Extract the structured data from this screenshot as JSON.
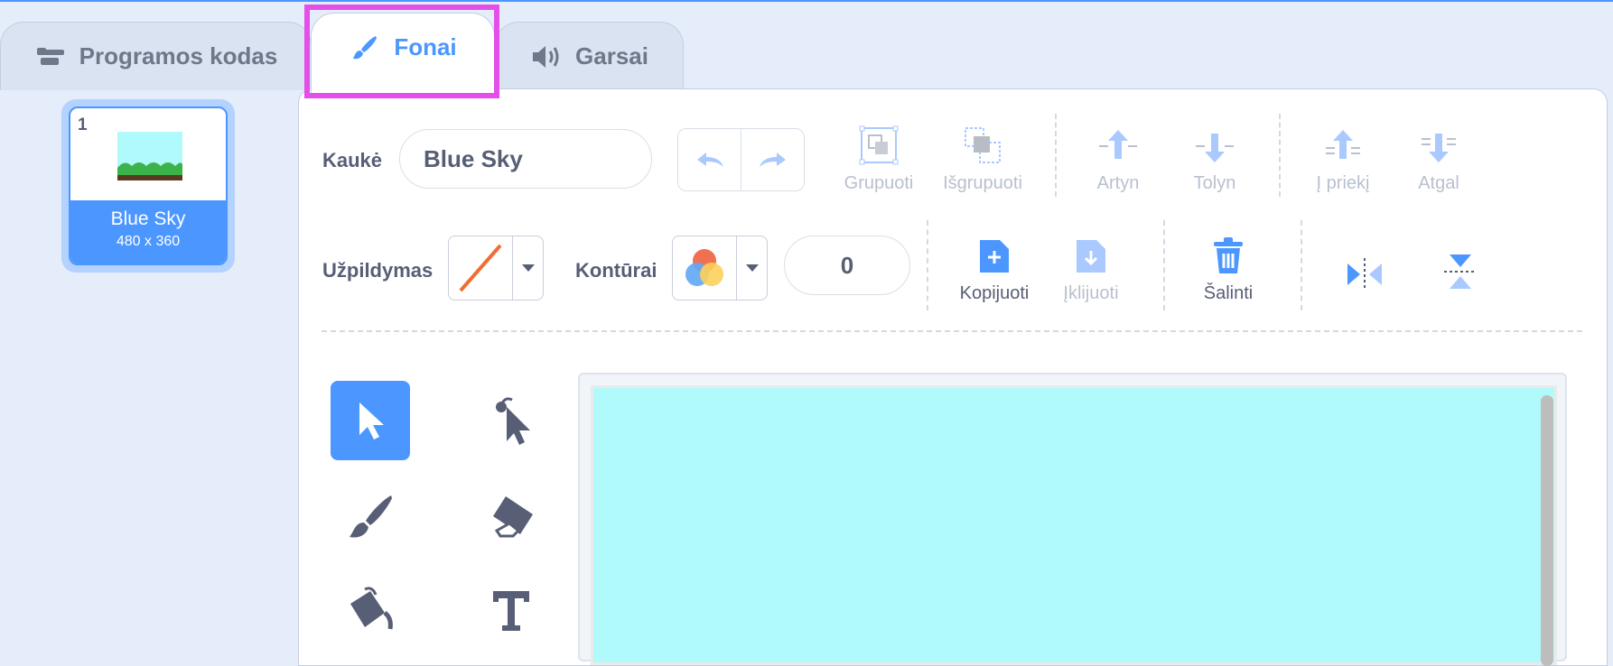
{
  "tabs": {
    "code": {
      "label": "Programos kodas",
      "icon": "code-blocks-icon"
    },
    "costumes": {
      "label": "Fonai",
      "icon": "paintbrush-icon"
    },
    "sounds": {
      "label": "Garsai",
      "icon": "speaker-icon"
    }
  },
  "costume_list": [
    {
      "number": "1",
      "name": "Blue Sky",
      "size": "480 x 360"
    }
  ],
  "editor": {
    "costume_label": "Kaukė",
    "costume_name": "Blue Sky",
    "group": "Grupuoti",
    "ungroup": "Išgrupuoti",
    "forward": "Artyn",
    "backward": "Tolyn",
    "front": "Į priekį",
    "back": "Atgal",
    "fill_label": "Užpildymas",
    "outline_label": "Kontūrai",
    "outline_width": "0",
    "copy": "Kopijuoti",
    "paste": "Įklijuoti",
    "delete": "Šalinti"
  },
  "colors": {
    "accent": "#4c97ff",
    "highlight": "#e34fe8",
    "canvas": "#b0fafc"
  }
}
